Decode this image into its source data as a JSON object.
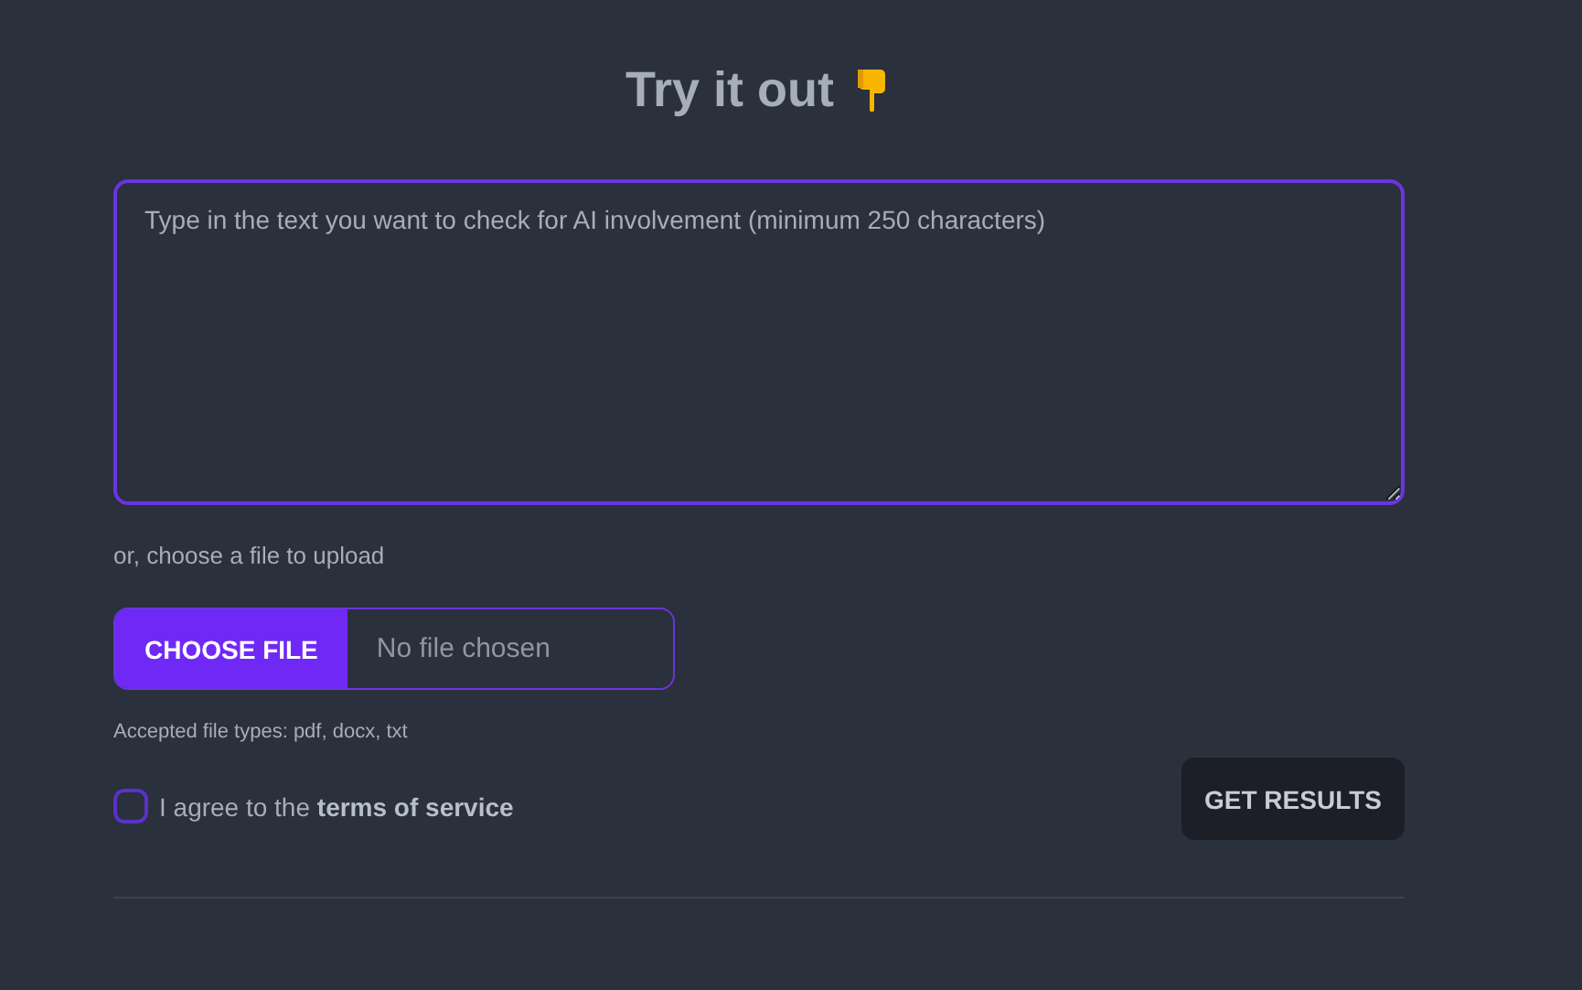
{
  "heading": {
    "title": "Try it out"
  },
  "text_input": {
    "placeholder": "Type in the text you want to check for AI involvement (minimum 250 characters)"
  },
  "upload": {
    "label": "or, choose a file to upload",
    "button": "CHOOSE FILE",
    "status": "No file chosen",
    "hint": "Accepted file types: pdf, docx, txt"
  },
  "agreement": {
    "label": "I agree to the **terms of service**",
    "checked": false
  },
  "submit": {
    "label": "GET RESULTS"
  }
}
